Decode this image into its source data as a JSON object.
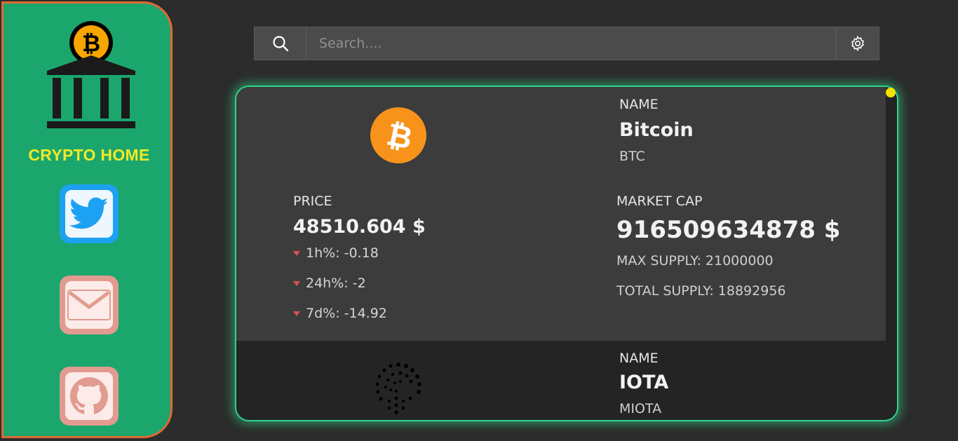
{
  "sidebar": {
    "brand": "CRYPTO HOME",
    "links": [
      {
        "name": "twitter-icon"
      },
      {
        "name": "mail-icon"
      },
      {
        "name": "github-icon"
      }
    ]
  },
  "search": {
    "placeholder": "Search...."
  },
  "colors": {
    "sidebar": "#1ba66d",
    "sidebar_border": "#e06a33",
    "accent": "#2fd38b",
    "brand_text": "#f1ea26",
    "negative": "#d9534f"
  },
  "coins": [
    {
      "name_label": "NAME",
      "name": "Bitcoin",
      "symbol": "BTC",
      "price_label": "PRICE",
      "price": "48510.604 $",
      "change_1h": "1h%: -0.18",
      "change_24h": "24h%: -2",
      "change_7d": "7d%: -14.92",
      "market_cap_label": "MARKET CAP",
      "market_cap": "916509634878 $",
      "max_supply": "MAX SUPPLY: 21000000",
      "total_supply": "TOTAL SUPPLY: 18892956"
    },
    {
      "name_label": "NAME",
      "name": "IOTA",
      "symbol": "MIOTA"
    }
  ]
}
